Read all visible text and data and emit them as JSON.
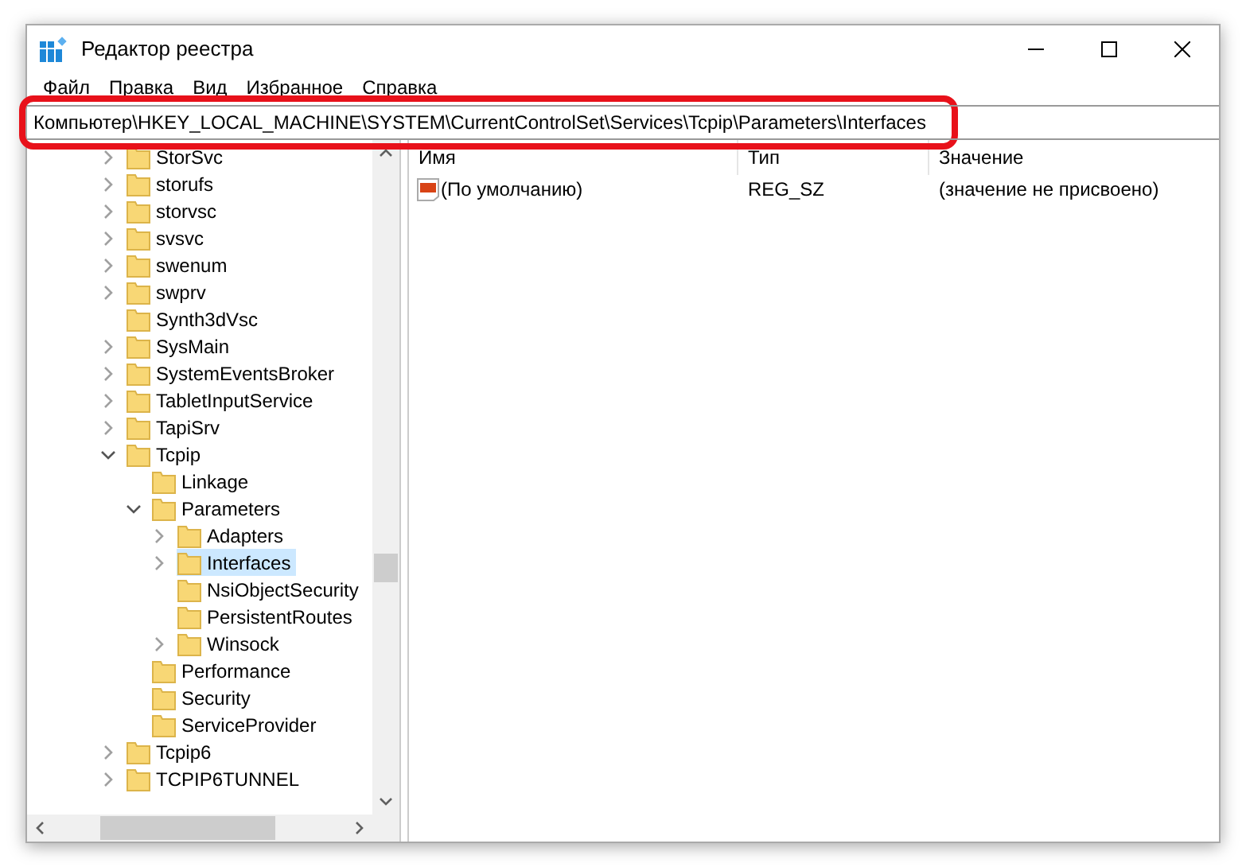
{
  "window": {
    "title": "Редактор реестра"
  },
  "menu": [
    "Файл",
    "Правка",
    "Вид",
    "Избранное",
    "Справка"
  ],
  "address": "Компьютер\\HKEY_LOCAL_MACHINE\\SYSTEM\\CurrentControlSet\\Services\\Tcpip\\Parameters\\Interfaces",
  "tree": [
    {
      "label": "StorSvc",
      "expanded": false,
      "selected": false
    },
    {
      "label": "storufs",
      "expanded": false,
      "selected": false
    },
    {
      "label": "storvsc",
      "expanded": false,
      "selected": false
    },
    {
      "label": "svsvc",
      "expanded": false,
      "selected": false
    },
    {
      "label": "swenum",
      "expanded": false,
      "selected": false
    },
    {
      "label": "swprv",
      "expanded": false,
      "selected": false
    },
    {
      "label": "Synth3dVsc",
      "selected": false
    },
    {
      "label": "SysMain",
      "expanded": false,
      "selected": false
    },
    {
      "label": "SystemEventsBroker",
      "expanded": false,
      "selected": false
    },
    {
      "label": "TabletInputService",
      "expanded": false,
      "selected": false
    },
    {
      "label": "TapiSrv",
      "expanded": false,
      "selected": false
    },
    {
      "label": "Tcpip",
      "expanded": true,
      "selected": false,
      "children": [
        {
          "label": "Linkage",
          "selected": false
        },
        {
          "label": "Parameters",
          "expanded": true,
          "selected": false,
          "children": [
            {
              "label": "Adapters",
              "expanded": false,
              "selected": false
            },
            {
              "label": "Interfaces",
              "expanded": false,
              "selected": true
            },
            {
              "label": "NsiObjectSecurity",
              "selected": false
            },
            {
              "label": "PersistentRoutes",
              "selected": false
            },
            {
              "label": "Winsock",
              "expanded": false,
              "selected": false
            }
          ]
        },
        {
          "label": "Performance",
          "selected": false
        },
        {
          "label": "Security",
          "selected": false
        },
        {
          "label": "ServiceProvider",
          "selected": false
        }
      ]
    },
    {
      "label": "Tcpip6",
      "expanded": false,
      "selected": false
    },
    {
      "label": "TCPIP6TUNNEL",
      "expanded": false,
      "selected": false
    }
  ],
  "values": {
    "columns": [
      "Имя",
      "Тип",
      "Значение"
    ],
    "rows": [
      {
        "name": "(По умолчанию)",
        "type": "REG_SZ",
        "data": "(значение не присвоено)"
      }
    ]
  }
}
